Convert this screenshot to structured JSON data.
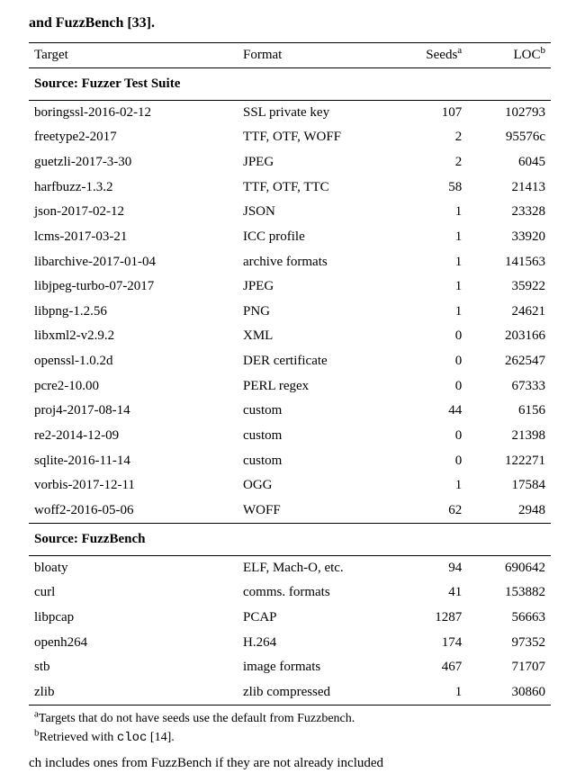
{
  "chart_data": {
    "type": "table",
    "columns": [
      "Target",
      "Format",
      "Seeds",
      "LOC"
    ],
    "sources": [
      {
        "name": "Fuzzer Test Suite",
        "rows": [
          {
            "target": "boringssl-2016-02-12",
            "format": "SSL private key",
            "seeds": 107,
            "loc": 102793
          },
          {
            "target": "freetype2-2017",
            "format": "TTF, OTF, WOFF",
            "seeds": 2,
            "loc": "95576c"
          },
          {
            "target": "guetzli-2017-3-30",
            "format": "JPEG",
            "seeds": 2,
            "loc": 6045
          },
          {
            "target": "harfbuzz-1.3.2",
            "format": "TTF, OTF, TTC",
            "seeds": 58,
            "loc": 21413
          },
          {
            "target": "json-2017-02-12",
            "format": "JSON",
            "seeds": 1,
            "loc": 23328
          },
          {
            "target": "lcms-2017-03-21",
            "format": "ICC profile",
            "seeds": 1,
            "loc": 33920
          },
          {
            "target": "libarchive-2017-01-04",
            "format": "archive formats",
            "seeds": 1,
            "loc": 141563
          },
          {
            "target": "libjpeg-turbo-07-2017",
            "format": "JPEG",
            "seeds": 1,
            "loc": 35922
          },
          {
            "target": "libpng-1.2.56",
            "format": "PNG",
            "seeds": 1,
            "loc": 24621
          },
          {
            "target": "libxml2-v2.9.2",
            "format": "XML",
            "seeds": 0,
            "loc": 203166
          },
          {
            "target": "openssl-1.0.2d",
            "format": "DER certificate",
            "seeds": 0,
            "loc": 262547
          },
          {
            "target": "pcre2-10.00",
            "format": "PERL regex",
            "seeds": 0,
            "loc": 67333
          },
          {
            "target": "proj4-2017-08-14",
            "format": "custom",
            "seeds": 44,
            "loc": 6156
          },
          {
            "target": "re2-2014-12-09",
            "format": "custom",
            "seeds": 0,
            "loc": 21398
          },
          {
            "target": "sqlite-2016-11-14",
            "format": "custom",
            "seeds": 0,
            "loc": 122271
          },
          {
            "target": "vorbis-2017-12-11",
            "format": "OGG",
            "seeds": 1,
            "loc": 17584
          },
          {
            "target": "woff2-2016-05-06",
            "format": "WOFF",
            "seeds": 62,
            "loc": 2948
          }
        ]
      },
      {
        "name": "FuzzBench",
        "rows": [
          {
            "target": "bloaty",
            "format": "ELF, Mach-O, etc.",
            "seeds": 94,
            "loc": 690642
          },
          {
            "target": "curl",
            "format": "comms. formats",
            "seeds": 41,
            "loc": 153882
          },
          {
            "target": "libpcap",
            "format": "PCAP",
            "seeds": 1287,
            "loc": 56663
          },
          {
            "target": "openh264",
            "format": "H.264",
            "seeds": 174,
            "loc": 97352
          },
          {
            "target": "stb",
            "format": "image formats",
            "seeds": 467,
            "loc": 71707
          },
          {
            "target": "zlib",
            "format": "zlib compressed",
            "seeds": 1,
            "loc": 30860
          }
        ]
      }
    ]
  },
  "fragments": {
    "top": "and FuzzBench [33].",
    "bottom": "ch includes ones from FuzzBench if they are not already included"
  },
  "labels": {
    "source_prefix": "Source: ",
    "seeds_sup": "a",
    "loc_sup": "b"
  },
  "footnotes": {
    "a_pre": "a",
    "a_text": "Targets that do not have seeds use the default from Fuzzbench.",
    "b_pre": "b",
    "b_text_1": "Retrieved with ",
    "b_mono": "cloc",
    "b_text_2": " [14]."
  }
}
